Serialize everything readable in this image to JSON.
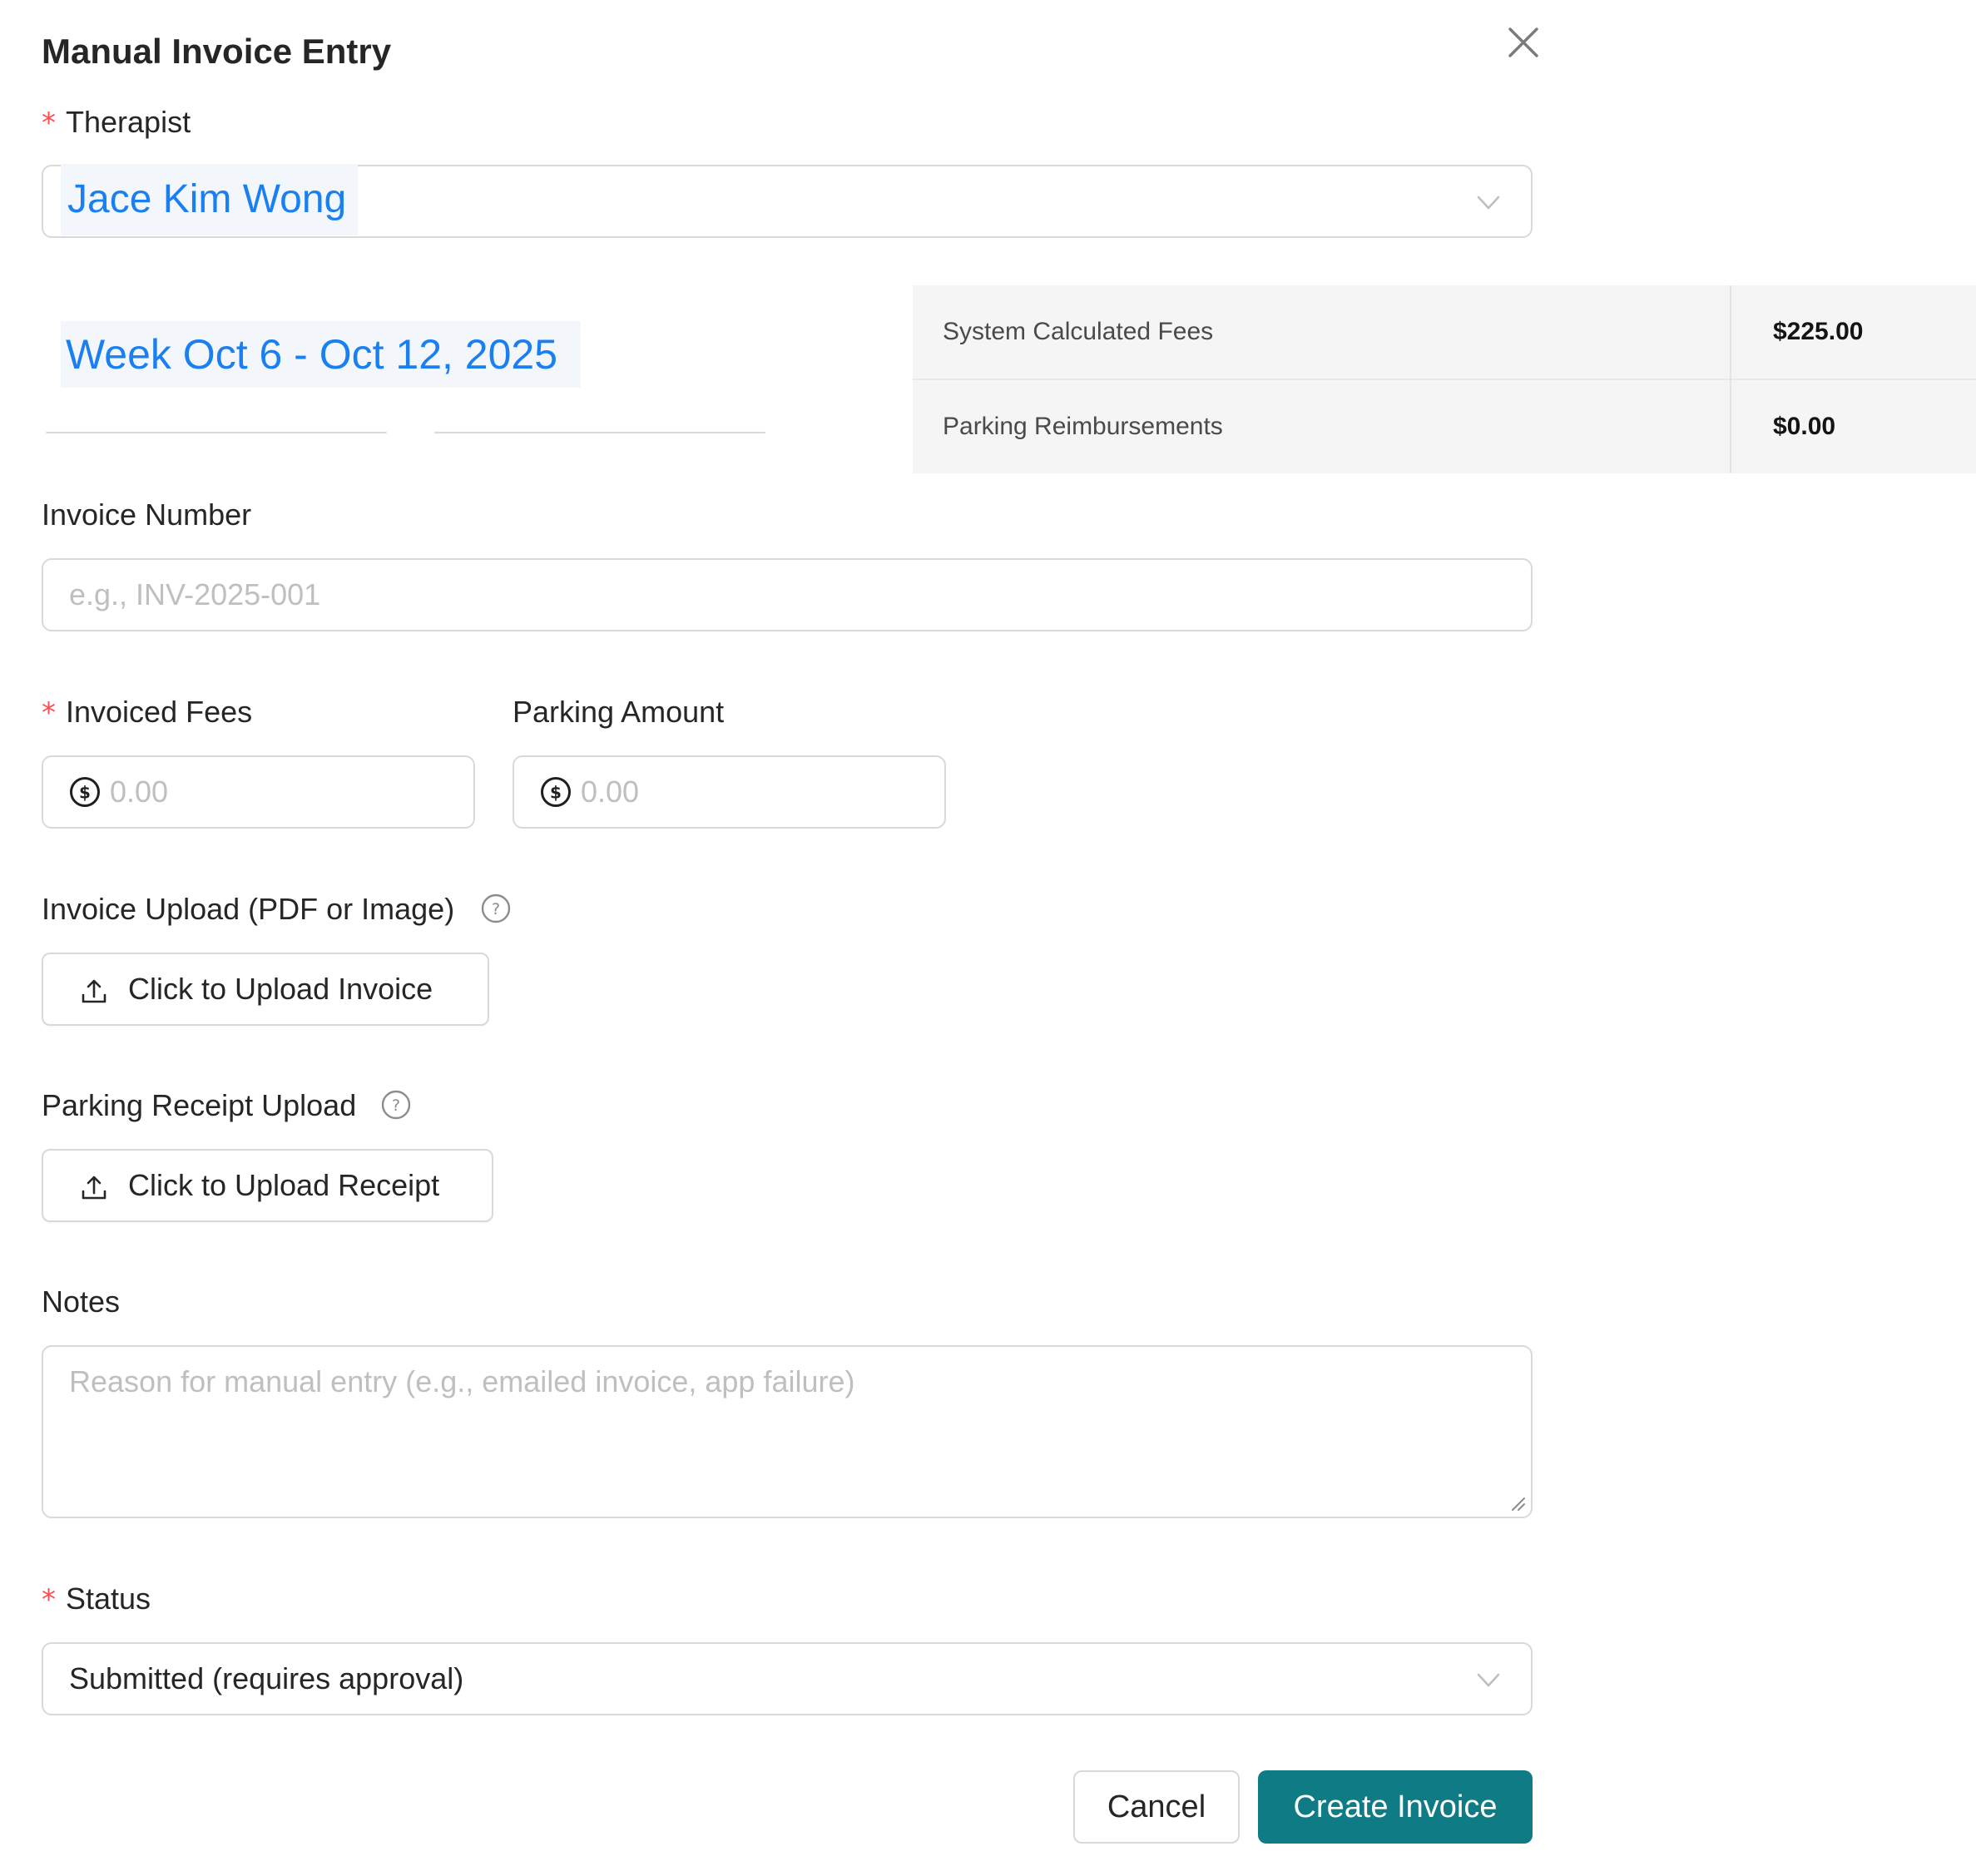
{
  "modal": {
    "title": "Manual Invoice Entry"
  },
  "therapist": {
    "label": "Therapist",
    "required_mark": "*",
    "value": "Jace Kim Wong"
  },
  "week": {
    "label": "Week Oct 6 - Oct 12, 2025"
  },
  "fees_summary": {
    "rows": [
      {
        "name": "System Calculated Fees",
        "value": "$225.00"
      },
      {
        "name": "Parking Reimbursements",
        "value": "$0.00"
      }
    ]
  },
  "invoice_number": {
    "label": "Invoice Number",
    "placeholder": "e.g., INV-2025-001"
  },
  "invoiced_fees": {
    "label": "Invoiced Fees",
    "required_mark": "*",
    "placeholder": "0.00"
  },
  "parking_amount": {
    "label": "Parking Amount",
    "placeholder": "0.00"
  },
  "invoice_upload": {
    "label": "Invoice Upload (PDF or Image)",
    "button_label": "Click to Upload Invoice"
  },
  "receipt_upload": {
    "label": "Parking Receipt Upload",
    "button_label": "Click to Upload Receipt"
  },
  "notes": {
    "label": "Notes",
    "placeholder": "Reason for manual entry (e.g., emailed invoice, app failure)"
  },
  "status": {
    "label": "Status",
    "required_mark": "*",
    "value": "Submitted (requires approval)"
  },
  "footer": {
    "cancel_label": "Cancel",
    "create_label": "Create Invoice"
  },
  "colors": {
    "accent": "#1a7ff0",
    "primary_button": "#0f7b84",
    "required": "#ff4d4f"
  },
  "icons": {
    "close": "close-icon",
    "select_arrow": "chevron-down-icon",
    "currency": "dollar-circle-icon",
    "help": "question-circle-icon",
    "upload": "upload-icon"
  }
}
